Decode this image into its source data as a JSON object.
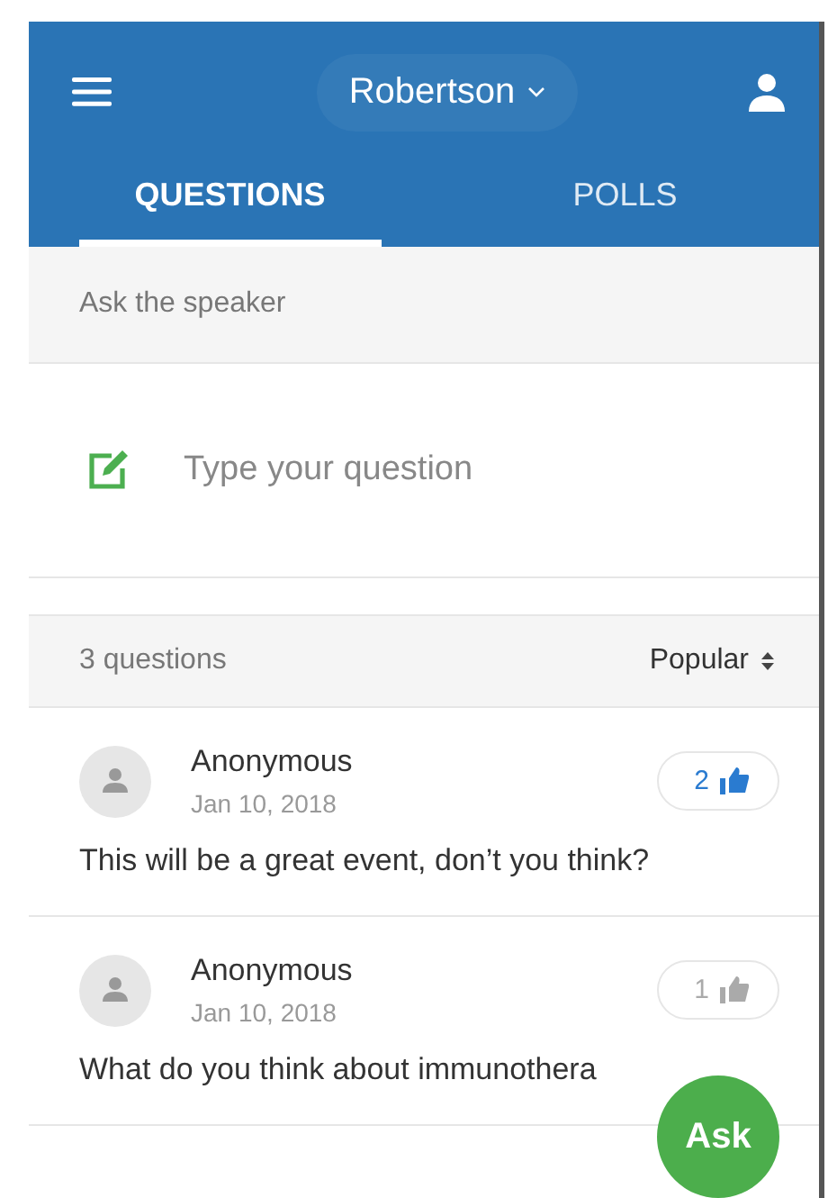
{
  "header": {
    "event": "Robertson"
  },
  "tabs": [
    {
      "label": "QUESTIONS",
      "selected": true
    },
    {
      "label": "POLLS",
      "selected": false
    }
  ],
  "ask_section": {
    "title": "Ask the speaker",
    "placeholder": "Type your question"
  },
  "list_header": {
    "count": "3 questions",
    "sort": "Popular"
  },
  "questions": [
    {
      "author": "Anonymous",
      "date": "Jan 10, 2018",
      "likes": "2",
      "liked": true,
      "text": "This will be a great event, don’t you think?"
    },
    {
      "author": "Anonymous",
      "date": "Jan 10, 2018",
      "likes": "1",
      "liked": false,
      "text": "What do you think about immunothera"
    }
  ],
  "fab": {
    "label": "Ask"
  }
}
